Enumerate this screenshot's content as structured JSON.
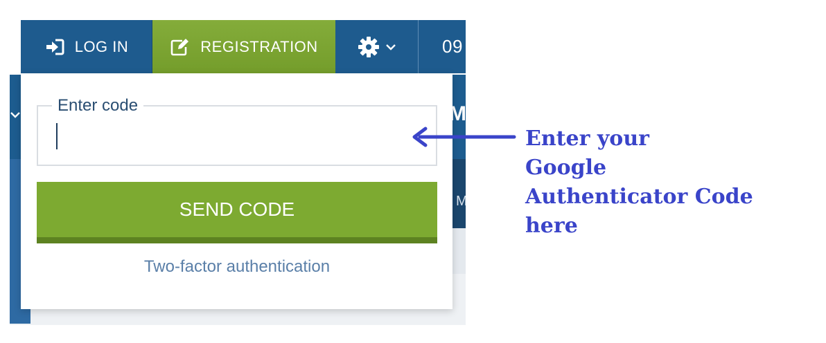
{
  "header": {
    "login_label": "LOG IN",
    "registration_label": "REGISTRATION",
    "phone_partial": "09",
    "icons": {
      "login": "sign-in-icon",
      "registration": "edit-icon",
      "settings": "gear-icon",
      "settings_caret": "chevron-down-icon"
    }
  },
  "background": {
    "fragment_mo": "MC",
    "fragment_m": "M"
  },
  "popup": {
    "code_legend": "Enter code",
    "code_value": "",
    "send_label": "SEND CODE",
    "tfa_link": "Two-factor authentication"
  },
  "annotation": {
    "lines": [
      "Enter your",
      "Google",
      "Authenticator Code",
      "here"
    ],
    "color": "#3a44c9"
  },
  "colors": {
    "header_blue": "#1e5b8e",
    "registration_green": "#7daa31",
    "send_green": "#7daa31",
    "link_blue": "#5a7fa8"
  }
}
